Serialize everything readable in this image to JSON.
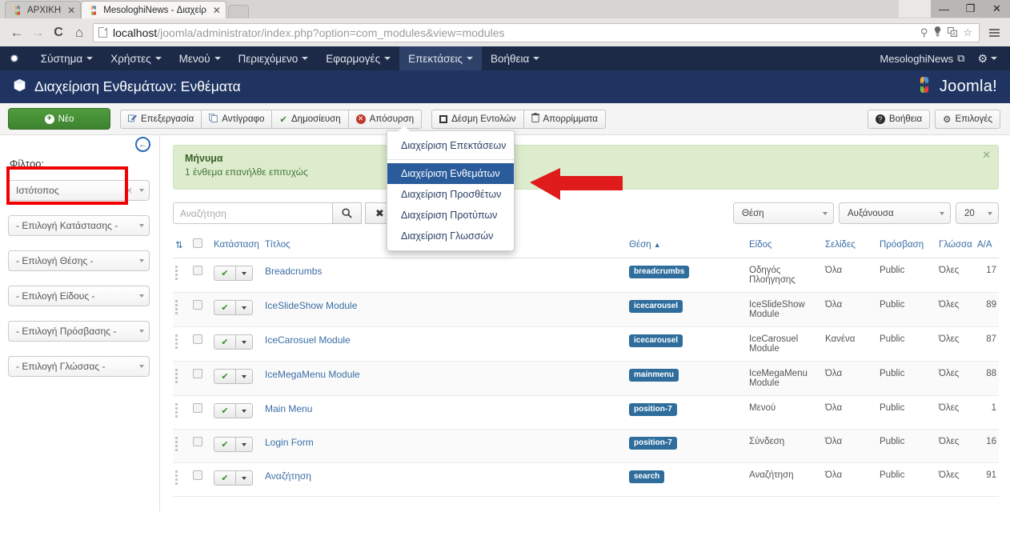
{
  "browser": {
    "tabs": [
      {
        "title": "ΑΡΧΙΚΗ",
        "close": "✕",
        "active": false
      },
      {
        "title": "MesologhiNews - Διαχείρ",
        "close": "✕",
        "active": true
      }
    ],
    "window_controls": {
      "minimize": "—",
      "maximize": "❐",
      "close": "✕"
    },
    "nav": {
      "back": "←",
      "forward": "→",
      "reload": "C",
      "home": "⌂"
    },
    "url_prefix": "localhost",
    "url_suffix": "/joomla/administrator/index.php?option=com_modules&view=modules",
    "omni_icons": {
      "zoom": "⚲",
      "bulb": "⬤",
      "translate": "❐",
      "star": "☆"
    }
  },
  "topmenu": {
    "logo_icon": "✹",
    "items": [
      {
        "label": "Σύστημα",
        "caret": true,
        "open": false
      },
      {
        "label": "Χρήστες",
        "caret": true,
        "open": false
      },
      {
        "label": "Μενού",
        "caret": true,
        "open": false
      },
      {
        "label": "Περιεχόμενο",
        "caret": true,
        "open": false
      },
      {
        "label": "Εφαρμογές",
        "caret": true,
        "open": false
      },
      {
        "label": "Επεκτάσεις",
        "caret": true,
        "open": true
      },
      {
        "label": "Βοήθεια",
        "caret": true,
        "open": false
      }
    ],
    "site_name": "MesologhiNews",
    "site_link_icon": "⧉",
    "gear_icon": "⚙"
  },
  "dropdown": {
    "items": [
      {
        "label": "Διαχείριση Επεκτάσεων",
        "active": false,
        "sep_after": true
      },
      {
        "label": "Διαχείριση Ενθεμάτων",
        "active": true,
        "sep_after": false
      },
      {
        "label": "Διαχείριση Προσθέτων",
        "active": false,
        "sep_after": false
      },
      {
        "label": "Διαχείριση Προτύπων",
        "active": false,
        "sep_after": false
      },
      {
        "label": "Διαχείριση Γλωσσών",
        "active": false,
        "sep_after": false
      }
    ]
  },
  "subheader": {
    "icon": "⬡",
    "title": "Διαχείριση Ενθεμάτων: Ενθέματα",
    "brand": "Joomla!",
    "brand_glyph": "✹"
  },
  "toolbar": {
    "new_label": "Νέο",
    "edit_label": "Επεξεργασία",
    "copy_label": "Αντίγραφο",
    "publish_label": "Δημοσίευση",
    "unpublish_label": "Απόσυρση",
    "batch_label": "Δέσμη Εντολών",
    "trash_label": "Απορρίμματα",
    "help_label": "Βοήθεια",
    "options_label": "Επιλογές",
    "icons": {
      "new": "+",
      "edit": "✎",
      "copy": "⧉",
      "publish": "✔",
      "unpublish": "✕",
      "batch": "■",
      "trash": "Ὕ1",
      "help": "?",
      "options": "⚙"
    }
  },
  "sidebar": {
    "collapse_icon": "←",
    "filter_label": "Φίλτρο:",
    "filters": [
      {
        "value": "Ιστότοπος",
        "clearable": true
      },
      {
        "value": "- Επιλογή Κατάστασης -",
        "clearable": false
      },
      {
        "value": "- Επιλογή Θέσης -",
        "clearable": false
      },
      {
        "value": "- Επιλογή Είδους -",
        "clearable": false
      },
      {
        "value": "- Επιλογή Πρόσβασης -",
        "clearable": false
      },
      {
        "value": "- Επιλογή Γλώσσας -",
        "clearable": false
      }
    ],
    "clear_icon": "✕"
  },
  "alert": {
    "title": "Μήνυμα",
    "text": "1 ένθεμα επανήλθε επιτυχώς",
    "close": "✕"
  },
  "search": {
    "placeholder": "Αναζήτηση",
    "value": "",
    "search_icon": "ὐD",
    "clear_icon": "✖"
  },
  "sorting": {
    "order_by": "Θέση",
    "direction": "Αυξάνουσα",
    "limit": "20"
  },
  "table": {
    "headers": {
      "drag": "⇅",
      "check": "",
      "state": "Κατάσταση",
      "title": "Τίτλος",
      "position": "Θέση",
      "position_sort": "▲",
      "type": "Είδος",
      "pages": "Σελίδες",
      "access": "Πρόσβαση",
      "language": "Γλώσσα",
      "id": "Α/Α"
    },
    "rows": [
      {
        "title": "Breadcrumbs",
        "position": "breadcrumbs",
        "type": "Οδηγός Πλοήγησης",
        "pages": "Όλα",
        "access": "Public",
        "language": "Όλες",
        "id": "17",
        "state_icon": "✔"
      },
      {
        "title": "IceSlideShow Module",
        "position": "icecarousel",
        "type": "IceSlideShow Module",
        "pages": "Όλα",
        "access": "Public",
        "language": "Όλες",
        "id": "89",
        "state_icon": "✔"
      },
      {
        "title": "IceCarosuel Module",
        "position": "icecarousel",
        "type": "IceCarosuel Module",
        "pages": "Κανένα",
        "access": "Public",
        "language": "Όλες",
        "id": "87",
        "state_icon": "✔"
      },
      {
        "title": "IceMegaMenu Module",
        "position": "mainmenu",
        "type": "IceMegaMenu Module",
        "pages": "Όλα",
        "access": "Public",
        "language": "Όλες",
        "id": "88",
        "state_icon": "✔"
      },
      {
        "title": "Main Menu",
        "position": "position-7",
        "type": "Μενού",
        "pages": "Όλα",
        "access": "Public",
        "language": "Όλες",
        "id": "1",
        "state_icon": "✔"
      },
      {
        "title": "Login Form",
        "position": "position-7",
        "type": "Σύνδεση",
        "pages": "Όλα",
        "access": "Public",
        "language": "Όλες",
        "id": "16",
        "state_icon": "✔"
      },
      {
        "title": "Αναζήτηση",
        "position": "search",
        "type": "Αναζήτηση",
        "pages": "Όλα",
        "access": "Public",
        "language": "Όλες",
        "id": "91",
        "state_icon": "✔"
      }
    ]
  },
  "annotations": {
    "highlight_color": "#f00000",
    "arrow_color": "#e01b1b"
  }
}
